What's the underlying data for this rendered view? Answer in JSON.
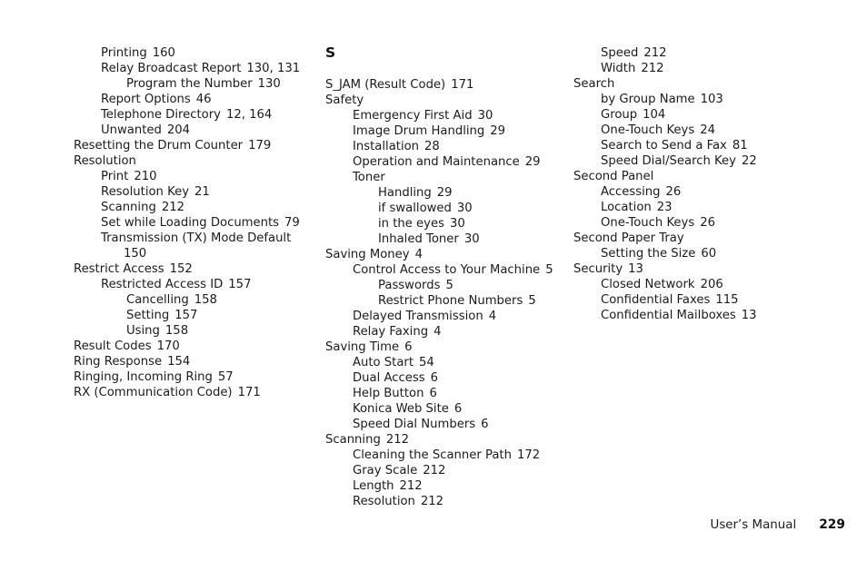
{
  "document": {
    "type": "index-page",
    "page_number": "229",
    "footer": {
      "label": "User’s Manual",
      "page": "229"
    }
  },
  "columns": [
    {
      "id": "column-1",
      "entries": [
        {
          "level": 1,
          "text": "Printing",
          "page": "160"
        },
        {
          "level": 1,
          "text": "Relay Broadcast Report",
          "page": "130, 131"
        },
        {
          "level": 2,
          "text": "Program the Number",
          "page": "130"
        },
        {
          "level": 1,
          "text": "Report Options",
          "page": "46"
        },
        {
          "level": 1,
          "text": "Telephone Directory",
          "page": "12, 164"
        },
        {
          "level": 1,
          "text": "Unwanted",
          "page": "204"
        },
        {
          "level": 0,
          "text": "Resetting the Drum Counter",
          "page": "179"
        },
        {
          "level": 0,
          "text": "Resolution",
          "page": ""
        },
        {
          "level": 1,
          "text": "Print",
          "page": "210"
        },
        {
          "level": 1,
          "text": "Resolution Key",
          "page": "21"
        },
        {
          "level": 1,
          "text": "Scanning",
          "page": "212"
        },
        {
          "level": 1,
          "text": "Set while Loading Documents",
          "page": "79"
        },
        {
          "level": 1,
          "text": "Transmission (TX) Mode Default",
          "page": ""
        },
        {
          "level": "cont",
          "text": "150",
          "page": ""
        },
        {
          "level": 0,
          "text": "Restrict Access",
          "page": "152"
        },
        {
          "level": 1,
          "text": "Restricted Access ID",
          "page": "157"
        },
        {
          "level": 2,
          "text": "Cancelling",
          "page": "158"
        },
        {
          "level": 2,
          "text": "Setting",
          "page": "157"
        },
        {
          "level": 2,
          "text": "Using",
          "page": "158"
        },
        {
          "level": 0,
          "text": "Result Codes",
          "page": "170"
        },
        {
          "level": 0,
          "text": "Ring Response",
          "page": "154"
        },
        {
          "level": 0,
          "text": "Ringing, Incoming Ring",
          "page": "57"
        },
        {
          "level": 0,
          "text": "RX  (Communication Code)",
          "page": "171"
        }
      ]
    },
    {
      "id": "column-2",
      "section_letter": "S",
      "entries": [
        {
          "level": 0,
          "text": "S_JAM (Result Code)",
          "page": "171"
        },
        {
          "level": 0,
          "text": "Safety",
          "page": ""
        },
        {
          "level": 1,
          "text": "Emergency First Aid",
          "page": "30"
        },
        {
          "level": 1,
          "text": "Image Drum Handling",
          "page": "29"
        },
        {
          "level": 1,
          "text": "Installation",
          "page": "28"
        },
        {
          "level": 1,
          "text": "Operation and Maintenance",
          "page": "29"
        },
        {
          "level": 1,
          "text": "Toner",
          "page": ""
        },
        {
          "level": 2,
          "text": "Handling",
          "page": "29"
        },
        {
          "level": 2,
          "text": "if swallowed",
          "page": "30"
        },
        {
          "level": 2,
          "text": "in the eyes",
          "page": "30"
        },
        {
          "level": 2,
          "text": "Inhaled Toner",
          "page": "30"
        },
        {
          "level": 0,
          "text": "Saving Money",
          "page": "4"
        },
        {
          "level": 1,
          "text": "Control Access to Your Machine",
          "page": "5"
        },
        {
          "level": 2,
          "text": "Passwords",
          "page": "5"
        },
        {
          "level": 2,
          "text": "Restrict Phone Numbers",
          "page": "5"
        },
        {
          "level": 1,
          "text": "Delayed Transmission",
          "page": "4"
        },
        {
          "level": 1,
          "text": "Relay Faxing",
          "page": "4"
        },
        {
          "level": 0,
          "text": "Saving Time",
          "page": "6"
        },
        {
          "level": 1,
          "text": "Auto Start",
          "page": "54"
        },
        {
          "level": 1,
          "text": "Dual Access",
          "page": "6"
        },
        {
          "level": 1,
          "text": "Help Button",
          "page": "6"
        },
        {
          "level": 1,
          "text": "Konica Web Site",
          "page": "6"
        },
        {
          "level": 1,
          "text": "Speed Dial Numbers",
          "page": "6"
        },
        {
          "level": 0,
          "text": "Scanning",
          "page": "212"
        },
        {
          "level": 1,
          "text": "Cleaning the Scanner Path",
          "page": "172"
        },
        {
          "level": 1,
          "text": "Gray Scale",
          "page": "212"
        },
        {
          "level": 1,
          "text": "Length",
          "page": "212"
        },
        {
          "level": 1,
          "text": "Resolution",
          "page": "212"
        }
      ]
    },
    {
      "id": "column-3",
      "entries": [
        {
          "level": 1,
          "text": "Speed",
          "page": "212"
        },
        {
          "level": 1,
          "text": "Width",
          "page": "212"
        },
        {
          "level": 0,
          "text": "Search",
          "page": ""
        },
        {
          "level": 1,
          "text": "by Group Name",
          "page": "103"
        },
        {
          "level": 1,
          "text": "Group",
          "page": "104"
        },
        {
          "level": 1,
          "text": "One-Touch Keys",
          "page": "24"
        },
        {
          "level": 1,
          "text": "Search to Send a Fax",
          "page": "81"
        },
        {
          "level": 1,
          "text": "Speed Dial/Search Key",
          "page": "22"
        },
        {
          "level": 0,
          "text": "Second Panel",
          "page": ""
        },
        {
          "level": 1,
          "text": "Accessing",
          "page": "26"
        },
        {
          "level": 1,
          "text": "Location",
          "page": "23"
        },
        {
          "level": 1,
          "text": "One-Touch Keys",
          "page": "26"
        },
        {
          "level": 0,
          "text": "Second Paper Tray",
          "page": ""
        },
        {
          "level": 1,
          "text": "Setting the Size",
          "page": "60"
        },
        {
          "level": 0,
          "text": "Security",
          "page": "13"
        },
        {
          "level": 1,
          "text": "Closed Network",
          "page": "206"
        },
        {
          "level": 1,
          "text": "Confidential Faxes",
          "page": "115"
        },
        {
          "level": 1,
          "text": "Confidential Mailboxes",
          "page": "13"
        }
      ]
    }
  ]
}
